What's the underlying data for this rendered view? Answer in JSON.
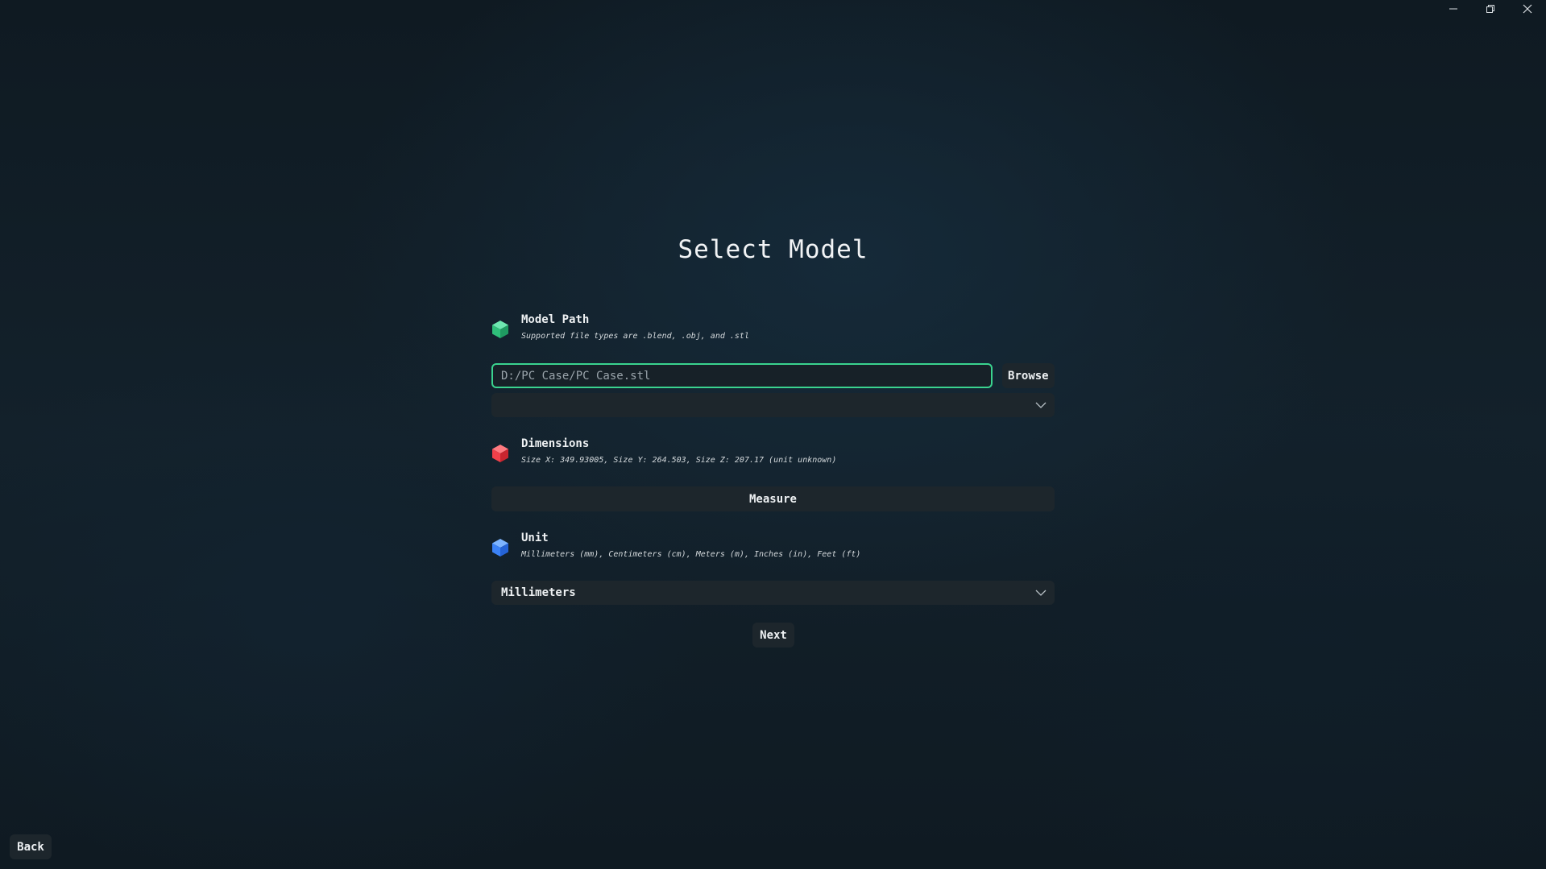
{
  "window": {
    "minimize_icon": "minimize-icon",
    "restore_icon": "restore-icon",
    "close_icon": "close-icon"
  },
  "page": {
    "title": "Select Model"
  },
  "model_path": {
    "icon": "green-cube-icon",
    "icon_color": "#3ecf8e",
    "title": "Model Path",
    "description": "Supported file types are .blend, .obj, and .stl",
    "input_value": "D:/PC Case/PC Case.stl",
    "browse_label": "Browse",
    "dropdown_value": ""
  },
  "dimensions": {
    "icon": "red-cube-icon",
    "icon_color": "#f0404a",
    "title": "Dimensions",
    "description": "Size X: 349.93005, Size Y: 264.503, Size Z: 207.17 (unit unknown)",
    "measure_label": "Measure"
  },
  "unit": {
    "icon": "blue-cube-icon",
    "icon_color": "#3b82f6",
    "title": "Unit",
    "description": "Millimeters (mm), Centimeters (cm), Meters (m), Inches (in), Feet (ft)",
    "selected": "Millimeters"
  },
  "actions": {
    "next_label": "Next",
    "back_label": "Back"
  }
}
